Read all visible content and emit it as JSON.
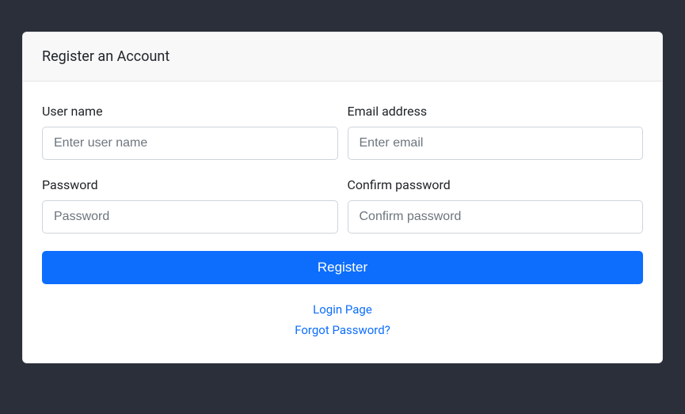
{
  "header": {
    "title": "Register an Account"
  },
  "form": {
    "username": {
      "label": "User name",
      "placeholder": "Enter user name",
      "value": ""
    },
    "email": {
      "label": "Email address",
      "placeholder": "Enter email",
      "value": ""
    },
    "password": {
      "label": "Password",
      "placeholder": "Password",
      "value": ""
    },
    "confirm_password": {
      "label": "Confirm password",
      "placeholder": "Confirm password",
      "value": ""
    },
    "submit_label": "Register"
  },
  "links": {
    "login": "Login Page",
    "forgot": "Forgot Password?"
  }
}
